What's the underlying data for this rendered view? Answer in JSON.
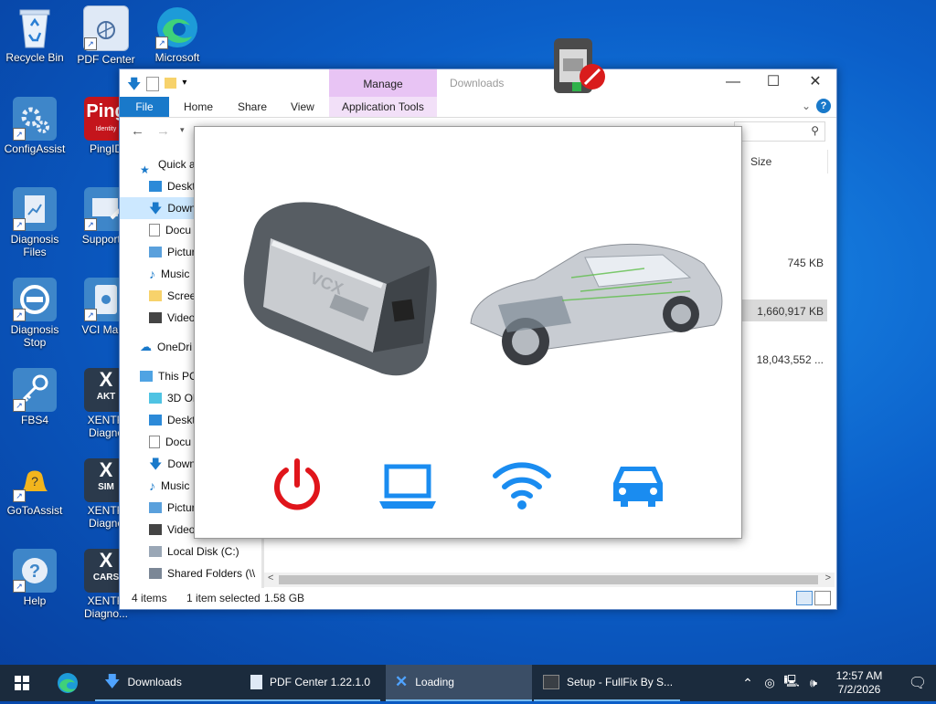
{
  "desktop": {
    "icons": [
      {
        "label": "Recycle Bin"
      },
      {
        "label": "PDF Center"
      },
      {
        "label": "Microsoft"
      },
      {
        "label": "ConfigAssist"
      },
      {
        "label": "PingID"
      },
      {
        "label": "Diagnosis Files"
      },
      {
        "label": "Support T"
      },
      {
        "label": "Diagnosis Stop"
      },
      {
        "label": "VCI Mana"
      },
      {
        "label": "FBS4"
      },
      {
        "label": "XENTR Diagno"
      },
      {
        "label": "GoToAssist"
      },
      {
        "label": "XENTR Diagno"
      },
      {
        "label": "Help"
      },
      {
        "label": "XENTR Diagno..."
      }
    ],
    "badges": {
      "aktiv": "AKT",
      "simul": "SIM",
      "cars": "CARS",
      "ping_sub": "Identity"
    }
  },
  "explorer": {
    "title": "Downloads",
    "context_group": "Manage",
    "ribbon_tabs": {
      "file": "File",
      "home": "Home",
      "share": "Share",
      "view": "View",
      "app_tools": "Application Tools"
    },
    "column_size": "Size",
    "file_sizes": {
      "row1": "745 KB",
      "row2": "1,660,917 KB",
      "row3": "18,043,552 ..."
    },
    "nav": [
      {
        "label": "Quick a"
      },
      {
        "label": "Deskt"
      },
      {
        "label": "Down"
      },
      {
        "label": "Docu"
      },
      {
        "label": "Pictur"
      },
      {
        "label": "Music"
      },
      {
        "label": "Scree"
      },
      {
        "label": "Video"
      },
      {
        "label": "OneDri"
      },
      {
        "label": "This PC"
      },
      {
        "label": "3D Ob"
      },
      {
        "label": "Deskt"
      },
      {
        "label": "Docu"
      },
      {
        "label": "Down"
      },
      {
        "label": "Music"
      },
      {
        "label": "Pictur"
      },
      {
        "label": "Videos"
      },
      {
        "label": "Local Disk (C:)"
      },
      {
        "label": "Shared Folders (\\\\"
      }
    ],
    "status": {
      "items": "4 items",
      "selected": "1 item selected",
      "size": "1.58 GB"
    }
  },
  "popup": {
    "device_label": "VCX",
    "status_icons": [
      "power-icon",
      "laptop-icon",
      "wifi-icon",
      "car-icon"
    ],
    "colors": {
      "power": "#e0151b",
      "device": "#1a8cf0"
    }
  },
  "taskbar": {
    "items": [
      {
        "label": "Downloads"
      },
      {
        "label": "PDF Center 1.22.1.0"
      },
      {
        "label": "Loading"
      },
      {
        "label": "Setup - FullFix By S..."
      }
    ],
    "time": "12:57 AM",
    "date": "7/2/2026"
  }
}
